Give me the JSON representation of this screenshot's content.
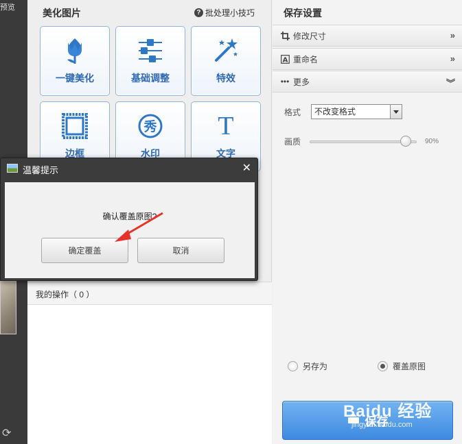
{
  "left": {
    "preview_label": "预览",
    "rotate_icon": "rotate-icon"
  },
  "center": {
    "title": "美化图片",
    "tips_label": "批处理小技巧",
    "tools": [
      {
        "label": "一键美化",
        "icon": "tulip-icon"
      },
      {
        "label": "基础调整",
        "icon": "sliders-icon"
      },
      {
        "label": "特效",
        "icon": "magic-wand-icon"
      },
      {
        "label": "边框",
        "icon": "frame-icon"
      },
      {
        "label": "水印",
        "icon": "watermark-icon",
        "glyph": "秀"
      },
      {
        "label": "文字",
        "icon": "text-icon",
        "glyph": "T"
      }
    ],
    "operations_label": "我的操作（ 0 ）"
  },
  "right": {
    "title": "保存设置",
    "rows": [
      {
        "label": "修改尺寸",
        "icon": "crop-icon",
        "chevron": "»"
      },
      {
        "label": "重命名",
        "icon": "rename-icon",
        "chevron": "»"
      },
      {
        "label": "更多",
        "icon": "more-icon",
        "chevron": "︾"
      }
    ],
    "format": {
      "label": "格式",
      "value": "不改变格式"
    },
    "quality": {
      "label": "画质",
      "value_text": "90%",
      "value": 0.9
    },
    "radios": {
      "save_as": "另存为",
      "overwrite": "覆盖原图",
      "selected": "overwrite"
    },
    "save_button": "保存"
  },
  "dialog": {
    "title": "温馨提示",
    "message": "确认覆盖原图?",
    "confirm": "确定覆盖",
    "cancel": "取消"
  },
  "watermark": {
    "brand": "Baidu 经验",
    "url": "jingyan.baidu.com"
  },
  "colors": {
    "accent": "#3e8ae0",
    "tool_text": "#2f6ab3",
    "tool_border": "#8fb6e1",
    "arrow": "#e8312a"
  }
}
